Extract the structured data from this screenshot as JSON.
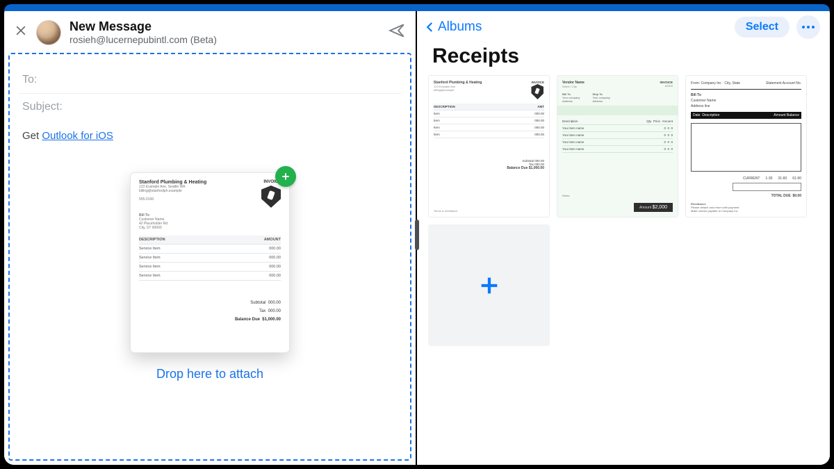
{
  "compose": {
    "title": "New Message",
    "from": "rosieh@lucernepubintl.com (Beta)",
    "to_label": "To:",
    "subject_label": "Subject:",
    "signature_prefix": "Get ",
    "signature_link": "Outlook for iOS",
    "drop_hint": "Drop here to attach"
  },
  "drag_receipt": {
    "company": "Stanford Plumbing & Heating",
    "addr1": "123 Example Ave, Seattle WA",
    "email": "billing@stanfordph.example",
    "phone": "555-0100",
    "invoice_label": "INVOICE",
    "billto": "Bill To",
    "line": "Service Item",
    "subtotal_label": "Subtotal",
    "tax_label": "Tax",
    "balance_label": "Balance Due",
    "balance": "$1,000.00"
  },
  "photos": {
    "back_label": "Albums",
    "select_label": "Select",
    "album_title": "Receipts",
    "green_total": "$2,000"
  }
}
